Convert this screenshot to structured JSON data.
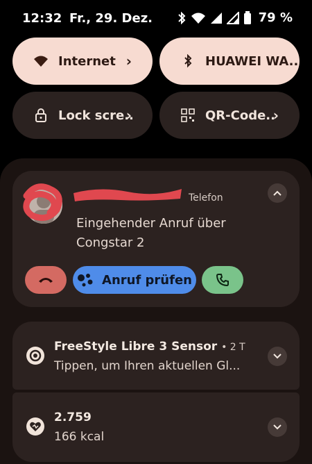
{
  "status_bar": {
    "time": "12:32",
    "date": "Fr., 29. Dez.",
    "battery": "79 %",
    "icons": [
      "bluetooth-icon",
      "wifi-icon",
      "signal-icon",
      "signal-icon",
      "battery-icon"
    ]
  },
  "quick_settings": [
    {
      "label": "Internet",
      "icon": "wifi-icon",
      "state": "on"
    },
    {
      "label": "HUAWEI WA..",
      "icon": "bluetooth-icon",
      "state": "on"
    },
    {
      "label": "Lock scre..",
      "icon": "lock-icon",
      "state": "off"
    },
    {
      "label": "QR-Code..",
      "icon": "qr-code-icon",
      "state": "off"
    }
  ],
  "call_notification": {
    "app": "Telefon",
    "text_line1": "Eingehender Anruf über",
    "text_line2": "Congstar 2",
    "actions": {
      "decline_icon": "hang-up-icon",
      "screen_label": "Anruf prüfen",
      "screen_icon": "assistant-icon",
      "accept_icon": "phone-icon"
    },
    "colors": {
      "decline": "#d46a62",
      "screen": "#4f8ce9",
      "accept": "#7ac38a"
    }
  },
  "notifications": [
    {
      "title": "FreeStyle Libre 3 Sensor",
      "meta": "• 2 T",
      "body": "Tippen, um Ihren aktuellen Gl...",
      "icon": "sensor-icon"
    },
    {
      "title": "2.759",
      "meta": "",
      "body": "166 kcal",
      "icon": "heart-icon"
    }
  ]
}
